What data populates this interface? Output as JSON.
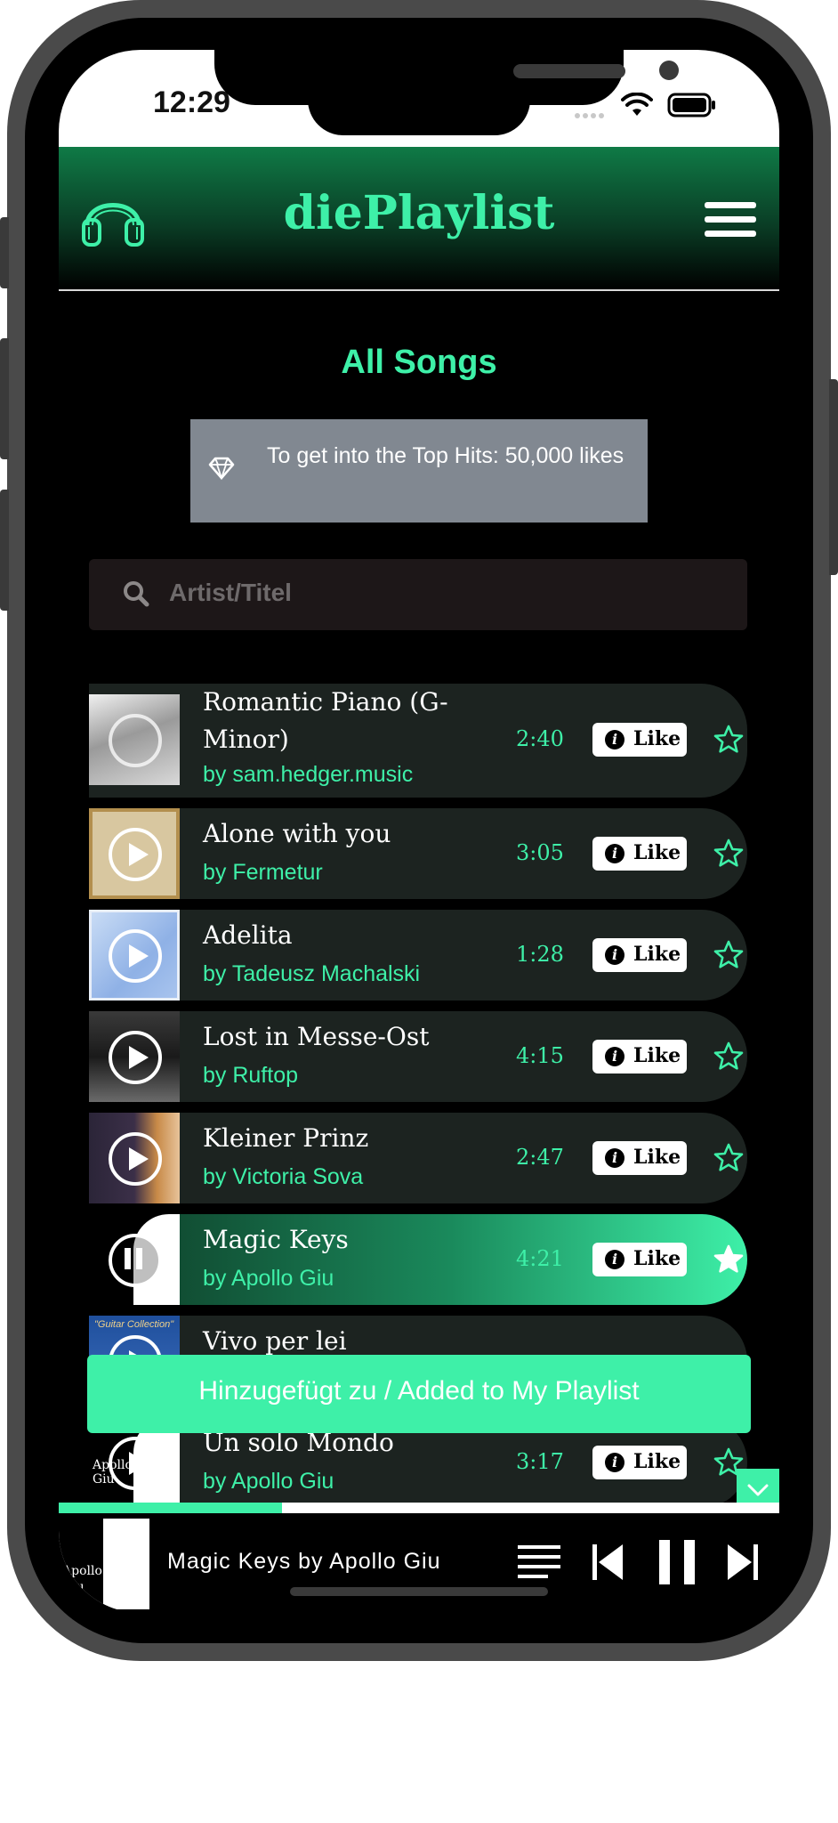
{
  "status_bar": {
    "time": "12:29"
  },
  "header": {
    "app_title": "diePlaylist",
    "logo_icon": "headphones-icon",
    "menu_icon": "hamburger-menu-icon"
  },
  "page": {
    "section_title": "All Songs",
    "info_banner": "To get into the Top Hits: 50,000 likes",
    "search": {
      "placeholder": "Artist/Titel",
      "value": ""
    }
  },
  "like_label": "Like",
  "songs": [
    {
      "title": "Romantic Piano (G-Minor)",
      "artist": "by sam.hedger.music",
      "duration": "2:40",
      "starred": false,
      "active": false
    },
    {
      "title": "Alone with you",
      "artist": "by Fermetur",
      "duration": "3:05",
      "starred": false,
      "active": false
    },
    {
      "title": "Adelita",
      "artist": "by Tadeusz Machalski",
      "duration": "1:28",
      "starred": false,
      "active": false
    },
    {
      "title": "Lost in Messe-Ost",
      "artist": "by Ruftop",
      "duration": "4:15",
      "starred": false,
      "active": false
    },
    {
      "title": "Kleiner Prinz",
      "artist": "by Victoria Sova",
      "duration": "2:47",
      "starred": false,
      "active": false
    },
    {
      "title": "Magic Keys",
      "artist": "by Apollo Giu",
      "duration": "4:21",
      "starred": true,
      "active": true
    },
    {
      "title": "Vivo per lei",
      "artist": "",
      "duration": "",
      "starred": false,
      "active": false
    },
    {
      "title": "Un solo Mondo",
      "artist": "by Apollo Giu",
      "duration": "3:17",
      "starred": false,
      "active": false
    }
  ],
  "cover_texts": {
    "apollo": "Apollo Giu",
    "guitar": "\"Guitar Collection\""
  },
  "toast": {
    "message": "Hinzugefügt zu / Added to My Playlist"
  },
  "player": {
    "now_playing": "Magic Keys by Apollo Giu",
    "progress": 0.31,
    "cover_text": "Apollo Giu"
  },
  "colors": {
    "accent": "#3ef0a8",
    "row_bg": "#1c2320",
    "info_bg": "#818891"
  }
}
